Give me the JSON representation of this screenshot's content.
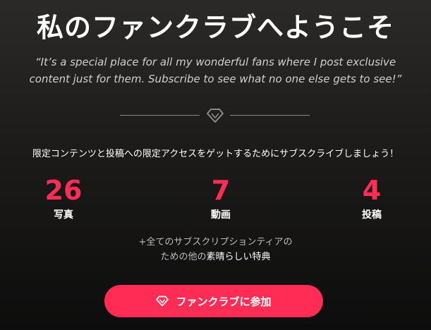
{
  "header": {
    "title": "私のファンクラブへようこそ",
    "quote_line1": "“It’s a special place for all my wonderful fans where I post exclusive",
    "quote_line2": "content just for them. Subscribe to see what no one else gets to see!”"
  },
  "divider": {
    "icon": "gem-icon"
  },
  "intro": "限定コンテンツと投稿への限定アクセスをゲットするためにサブスクライブしましょう！",
  "stats": [
    {
      "value": "26",
      "label": "写真"
    },
    {
      "value": "7",
      "label": "動画"
    },
    {
      "value": "4",
      "label": "投稿"
    }
  ],
  "perks": {
    "line1": "+全てのサブスクリプションティアの",
    "line2_pre": "ための他の",
    "line2_highlight": "素晴らしい特典"
  },
  "join_button": {
    "label": "ファンクラブに参加",
    "icon": "gem-icon"
  },
  "colors": {
    "accent": "#ff2d55",
    "background": "#1c1b1a",
    "text": "#ffffff",
    "muted": "#bdbdbd"
  }
}
